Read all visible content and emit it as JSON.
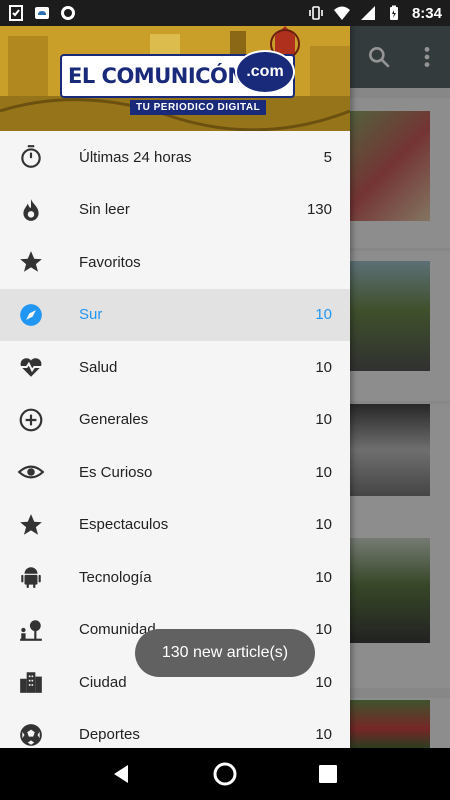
{
  "status_bar": {
    "time": "8:34",
    "left_icons": [
      "task-check-icon",
      "cloud-app-icon",
      "circle-app-icon"
    ],
    "right_icons": [
      "vibrate-icon",
      "wifi-icon",
      "signal-icon",
      "battery-icon"
    ]
  },
  "app": {
    "toolbar_icons": [
      "search-icon",
      "more-vert-icon"
    ],
    "toolbar_color": "#5b666a"
  },
  "drawer": {
    "logo": {
      "main": "EL COMUNICÓN",
      "suffix": ".com",
      "tagline": "TU PERIODICO DIGITAL"
    },
    "active_color": "#2196f3",
    "items": [
      {
        "icon": "timer-icon",
        "label": "Últimas 24 horas",
        "count": "5",
        "active": false
      },
      {
        "icon": "fire-icon",
        "label": "Sin leer",
        "count": "130",
        "active": false
      },
      {
        "icon": "star-icon",
        "label": "Favoritos",
        "count": "",
        "active": false
      },
      {
        "icon": "compass-icon",
        "label": "Sur",
        "count": "10",
        "active": true
      },
      {
        "icon": "heart-pulse-icon",
        "label": "Salud",
        "count": "10",
        "active": false
      },
      {
        "icon": "plus-circle-icon",
        "label": "Generales",
        "count": "10",
        "active": false
      },
      {
        "icon": "eye-icon",
        "label": "Es Curioso",
        "count": "10",
        "active": false
      },
      {
        "icon": "star-icon",
        "label": "Espectaculos",
        "count": "10",
        "active": false
      },
      {
        "icon": "android-icon",
        "label": "Tecnología",
        "count": "10",
        "active": false
      },
      {
        "icon": "community-icon",
        "label": "Comunidad",
        "count": "10",
        "active": false
      },
      {
        "icon": "city-icon",
        "label": "Ciudad",
        "count": "10",
        "active": false
      },
      {
        "icon": "soccer-ball-icon",
        "label": "Deportes",
        "count": "10",
        "active": false
      }
    ]
  },
  "toast": {
    "text": "130 new article(s)"
  },
  "nav_bar": {
    "buttons": [
      "back-icon",
      "home-icon",
      "recents-icon"
    ]
  }
}
